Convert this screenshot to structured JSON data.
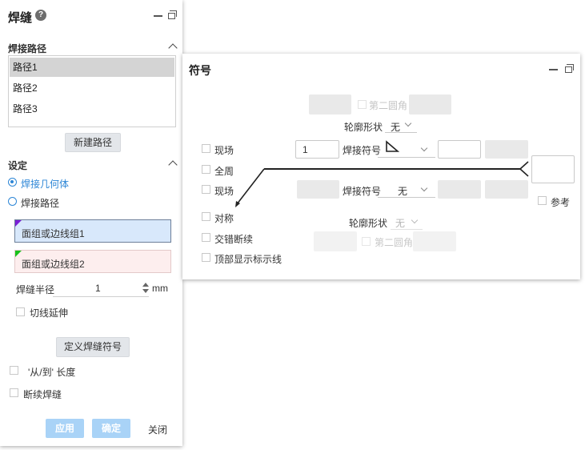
{
  "weld_panel": {
    "title": "焊缝",
    "help_icon": "?",
    "section_path": "焊接路径",
    "paths": [
      "路径1",
      "路径2",
      "路径3"
    ],
    "new_path_button": "新建路径",
    "section_settings": "设定",
    "radio_geometry": "焊接几何体",
    "radio_path": "焊接路径",
    "select_group1": "面组或边线组1",
    "select_group2": "面组或边线组2",
    "group1_color": "#7b1fd6",
    "group2_color": "#18c21b",
    "weld_radius_label": "焊缝半径",
    "weld_radius_value": "1",
    "weld_radius_unit": "mm",
    "tangent_extend": "切线延伸",
    "define_symbol_button": "定义焊缝符号",
    "from_to_length": "'从/到' 长度",
    "intermittent_weld": "断续焊缝",
    "apply_button": "应用",
    "ok_button": "确定",
    "close_button": "关闭"
  },
  "symbol_panel": {
    "title": "符号",
    "second_angle_top": "第二圆角",
    "contour_top_label": "轮廓形状",
    "contour_top_value": "无",
    "field_label": "现场",
    "all_around_label": "全周",
    "field_label2": "现场",
    "weld_symbol_top_label": "焊接符号",
    "weld_symbol_top_value": "1",
    "weld_symbol_bottom_label": "焊接符号",
    "weld_symbol_bottom_value": "无",
    "reference_label": "参考",
    "symmetric_label": "对称",
    "staggered_label": "交错断续",
    "contour_bottom_label": "轮廓形状",
    "contour_bottom_value": "无",
    "second_angle_bottom": "第二圆角",
    "top_show_label": "顶部显示标示线"
  }
}
